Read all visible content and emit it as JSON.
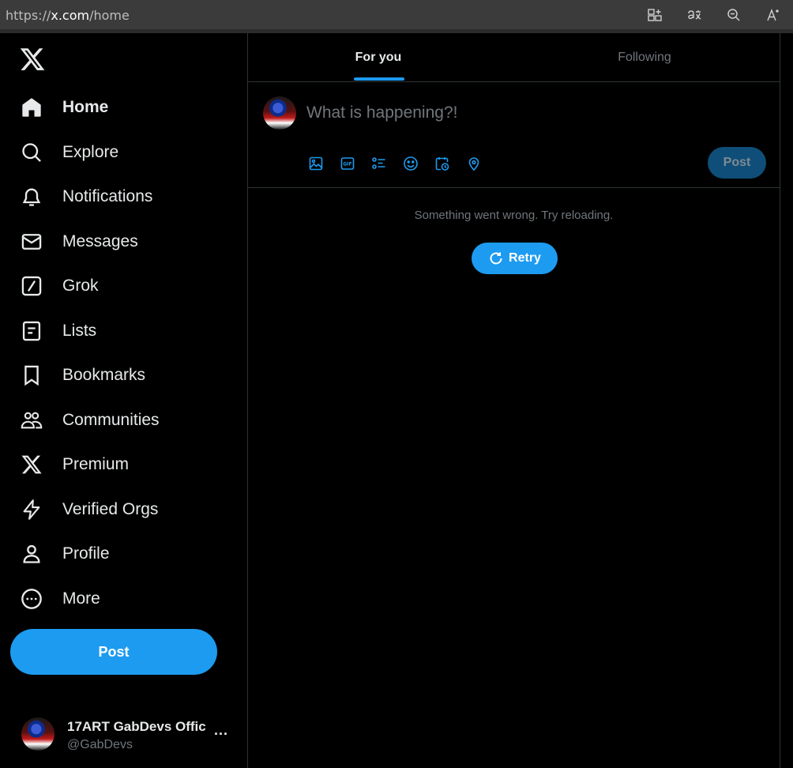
{
  "browser": {
    "url_scheme": "https://",
    "url_host": "x.com",
    "url_path": "/home",
    "icons": [
      "split-screen-icon",
      "translate-icon",
      "zoom-out-icon",
      "read-aloud-icon"
    ]
  },
  "sidebar": {
    "logo": "x-logo-icon",
    "items": [
      {
        "label": "Home",
        "icon": "home-icon",
        "active": true
      },
      {
        "label": "Explore",
        "icon": "search-icon"
      },
      {
        "label": "Notifications",
        "icon": "bell-icon"
      },
      {
        "label": "Messages",
        "icon": "envelope-icon"
      },
      {
        "label": "Grok",
        "icon": "grok-icon"
      },
      {
        "label": "Lists",
        "icon": "list-icon"
      },
      {
        "label": "Bookmarks",
        "icon": "bookmark-icon"
      },
      {
        "label": "Communities",
        "icon": "people-icon"
      },
      {
        "label": "Premium",
        "icon": "x-icon"
      },
      {
        "label": "Verified Orgs",
        "icon": "lightning-icon"
      },
      {
        "label": "Profile",
        "icon": "person-icon"
      },
      {
        "label": "More",
        "icon": "more-circle-icon"
      }
    ],
    "post_label": "Post",
    "account": {
      "name": "17ART GabDevs Offic",
      "handle": "@GabDevs",
      "more": "..."
    }
  },
  "main": {
    "tabs": [
      {
        "label": "For you",
        "active": true
      },
      {
        "label": "Following",
        "active": false
      }
    ],
    "composer": {
      "placeholder": "What is happening?!",
      "tools": [
        "image-icon",
        "gif-icon",
        "poll-icon",
        "emoji-icon",
        "schedule-icon",
        "location-icon"
      ],
      "post_label": "Post"
    },
    "error_message": "Something went wrong. Try reloading.",
    "retry_label": "Retry"
  },
  "colors": {
    "accent": "#1d9bf0",
    "background": "#000000",
    "text": "#e7e9ea",
    "muted": "#71767b",
    "border": "#2f3336"
  }
}
